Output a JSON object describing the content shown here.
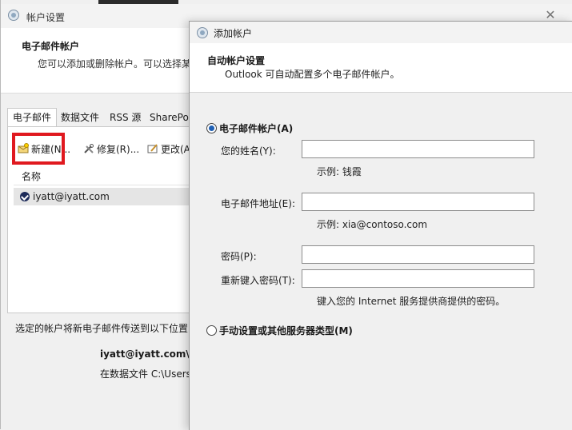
{
  "settings_window": {
    "title": "帐户设置",
    "heading": "电子邮件帐户",
    "description": "您可以添加或删除帐户。可以选择某",
    "tabs": [
      "电子邮件",
      "数据文件",
      "RSS 源",
      "SharePoi"
    ],
    "toolbar": {
      "new_label": "新建(N...",
      "repair_label": "修复(R)...",
      "change_label": "更改(A"
    },
    "column_header": "名称",
    "account": "iyatt@iyatt.com",
    "deliver_text": "选定的帐户将新电子邮件传送到以下位置:",
    "deliver_target": "iyatt@iyatt.com\\收",
    "data_file_text": "在数据文件 C:\\Users"
  },
  "add_account": {
    "title": "添加帐户",
    "heading": "自动帐户设置",
    "subheading": "Outlook 可自动配置多个电子邮件帐户。",
    "option_email": "电子邮件帐户(A)",
    "name_label": "您的姓名(Y):",
    "name_value": "",
    "name_hint": "示例: 钱霞",
    "email_label": "电子邮件地址(E):",
    "email_value": "",
    "email_hint": "示例: xia@contoso.com",
    "password_label": "密码(P):",
    "password_value": "",
    "retype_label": "重新键入密码(T):",
    "retype_value": "",
    "password_hint": "键入您的 Internet 服务提供商提供的密码。",
    "option_manual": "手动设置或其他服务器类型(M)"
  },
  "colors": {
    "highlight_box": "#e0191f",
    "radio_selected": "#1e5fb4"
  },
  "icons": [
    "outlook-window-icon",
    "new-account-icon",
    "repair-tools-icon",
    "change-account-icon",
    "default-check-icon",
    "close-icon"
  ]
}
